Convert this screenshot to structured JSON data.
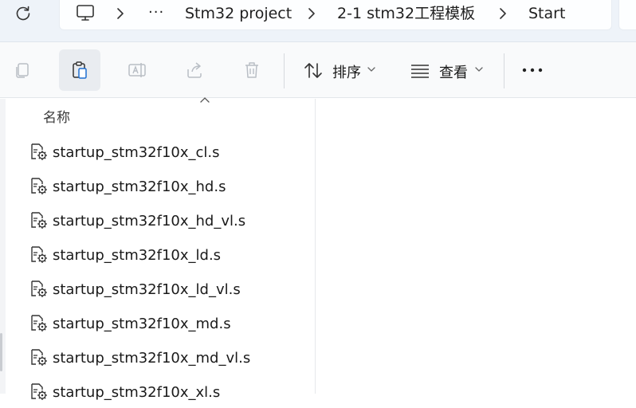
{
  "breadcrumb": {
    "items": [
      "Stm32 project",
      "2-1 stm32工程模板",
      "Start"
    ],
    "overflow": "···"
  },
  "toolbar": {
    "sort_label": "排序",
    "view_label": "查看",
    "more_label": "•••"
  },
  "file_list": {
    "column_name": "名称",
    "files": [
      "startup_stm32f10x_cl.s",
      "startup_stm32f10x_hd.s",
      "startup_stm32f10x_hd_vl.s",
      "startup_stm32f10x_ld.s",
      "startup_stm32f10x_ld_vl.s",
      "startup_stm32f10x_md.s",
      "startup_stm32f10x_md_vl.s",
      "startup_stm32f10x_xl.s"
    ]
  },
  "icons": {
    "refresh": "refresh-icon",
    "computer": "computer-icon",
    "file": "asm-file-icon",
    "copy": "copy-icon",
    "paste": "paste-icon",
    "rename": "rename-icon",
    "share": "share-icon",
    "delete": "delete-icon",
    "sort": "sort-icon",
    "view": "view-icon"
  },
  "colors": {
    "address_bar_bg": "#eef3f9",
    "toolbar_bg": "#f9fafb",
    "active_button_bg": "#e9ecf0",
    "disabled_icon": "#b9bec5"
  }
}
